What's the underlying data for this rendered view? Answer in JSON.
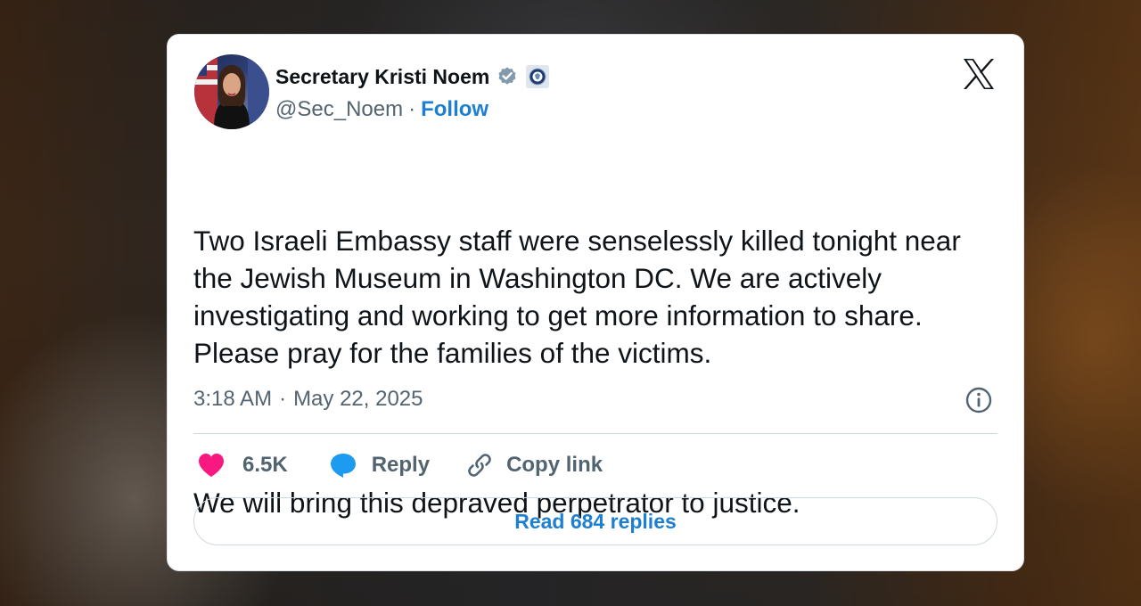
{
  "tweet": {
    "author_name": "Secretary Kristi Noem",
    "handle": "@Sec_Noem",
    "separator": "·",
    "follow_label": "Follow",
    "verified_icon": "verified-badge-icon",
    "affiliate_icon": "dhs-seal-icon",
    "platform_icon": "x-logo-icon",
    "text_paragraphs": [
      "Two Israeli Embassy staff were senselessly killed tonight near the Jewish Museum in Washington DC. We are actively investigating and working to get more information to share. Please pray for the families of the victims.",
      "We will bring this depraved perpetrator to justice."
    ],
    "time": "3:18 AM",
    "date": "May 22, 2025",
    "like_count": "6.5K",
    "reply_label": "Reply",
    "copy_link_label": "Copy link",
    "read_replies_label": "Read 684 replies"
  },
  "colors": {
    "link_blue": "#1d7fd1",
    "like_pink": "#f91880",
    "reply_blue": "#1d9bf0",
    "muted_text": "#536471",
    "text": "#0f1419"
  }
}
